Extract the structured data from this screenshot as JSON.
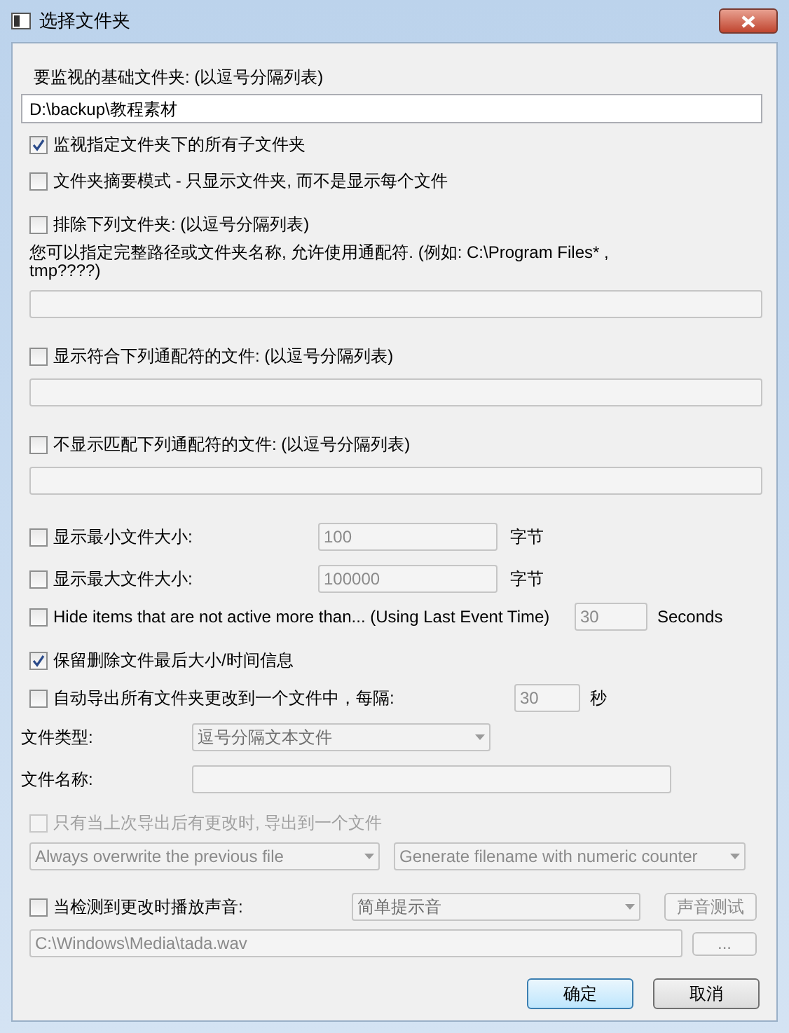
{
  "window": {
    "title": "选择文件夹"
  },
  "base_folder": {
    "label": "要监视的基础文件夹: (以逗号分隔列表)",
    "value": "D:\\backup\\教程素材"
  },
  "include_subfolders": {
    "label": "监视指定文件夹下的所有子文件夹",
    "checked": true
  },
  "summary_mode": {
    "label": "文件夹摘要模式 - 只显示文件夹, 而不是显示每个文件",
    "checked": false
  },
  "filters": [
    {
      "label": "排除下列文件夹: (以逗号分隔列表)",
      "checked": false,
      "note": "您可以指定完整路径或文件夹名称, 允许使用通配符. (例如: C:\\Program Files* , tmp????)"
    },
    {
      "label": "显示符合下列通配符的文件: (以逗号分隔列表)",
      "checked": false
    },
    {
      "label": "不显示匹配下列通配符的文件: (以逗号分隔列表)",
      "checked": false
    }
  ],
  "size_limits": [
    {
      "label": "显示最小文件大小:",
      "checked": false,
      "value": "100",
      "value_disabled": true,
      "unit": "字节"
    },
    {
      "label": "显示最大文件大小:",
      "checked": false,
      "value": "100000",
      "value_disabled": true,
      "unit": "字节"
    }
  ],
  "inactive": {
    "label": "Hide items that are not active more than... (Using Last Event Time)",
    "checked": false,
    "value": "30",
    "value_disabled": true,
    "unit": "Seconds"
  },
  "keep_deleted": {
    "label": "保留删除文件最后大小/时间信息",
    "checked": true
  },
  "auto_export": {
    "label": "自动导出所有文件夹更改到一个文件中，每隔:",
    "checked": false,
    "value": "30",
    "value_disabled": true,
    "unit": "秒"
  },
  "file_type": {
    "label": "文件类型:",
    "value": "逗号分隔文本文件"
  },
  "file_name": {
    "label": "文件名称:"
  },
  "only_changed": {
    "label": "只有当上次导出后有更改时, 导出到一个文件",
    "checked": false,
    "disabled": true
  },
  "export_options": [
    {
      "value": "Always overwrite the previous file"
    },
    {
      "value": "Generate filename with numeric counter"
    }
  ],
  "sound": {
    "label": "当检测到更改时播放声音:",
    "checked": false,
    "value": "简单提示音",
    "test_button": "声音测试",
    "path": "C:\\Windows\\Media\\tada.wav",
    "browse_button": "..."
  },
  "buttons": [
    {
      "label": "确定",
      "default": true
    },
    {
      "label": "取消",
      "default": false
    }
  ]
}
